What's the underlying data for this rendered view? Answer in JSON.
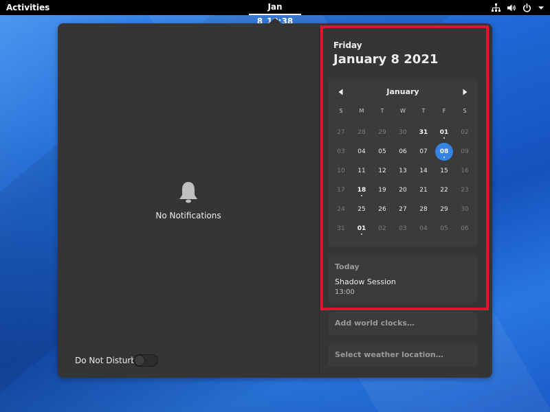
{
  "topbar": {
    "activities": "Activities",
    "clock_date": "Jan 8",
    "clock_time": "10:38"
  },
  "notifications": {
    "empty_text": "No Notifications",
    "dnd_label": "Do Not Disturb",
    "dnd_on": false
  },
  "date_header": {
    "weekday": "Friday",
    "full_date": "January 8 2021"
  },
  "calendar": {
    "month": "January",
    "weekdays": [
      "S",
      "M",
      "T",
      "W",
      "T",
      "F",
      "S"
    ],
    "weeks": [
      [
        "27",
        "28",
        "29",
        "30",
        "31",
        "01",
        "02"
      ],
      [
        "03",
        "04",
        "05",
        "06",
        "07",
        "08",
        "09"
      ],
      [
        "10",
        "11",
        "12",
        "13",
        "14",
        "15",
        "16"
      ],
      [
        "17",
        "18",
        "19",
        "20",
        "21",
        "22",
        "23"
      ],
      [
        "24",
        "25",
        "26",
        "27",
        "28",
        "29",
        "30"
      ],
      [
        "31",
        "01",
        "02",
        "03",
        "04",
        "05",
        "06"
      ]
    ],
    "selected_day": "08"
  },
  "events": {
    "heading": "Today",
    "items": [
      {
        "title": "Shadow Session",
        "time": "13:00"
      }
    ]
  },
  "world_clocks": {
    "label": "Add world clocks…"
  },
  "weather": {
    "label": "Select weather location…"
  },
  "colors": {
    "accent": "#3584e4",
    "highlight": "#e2142c",
    "panel": "#353535"
  },
  "icons": [
    "network-icon",
    "volume-icon",
    "power-icon",
    "chevron-down-icon",
    "bell-icon",
    "chevron-left-icon",
    "chevron-right-icon"
  ]
}
